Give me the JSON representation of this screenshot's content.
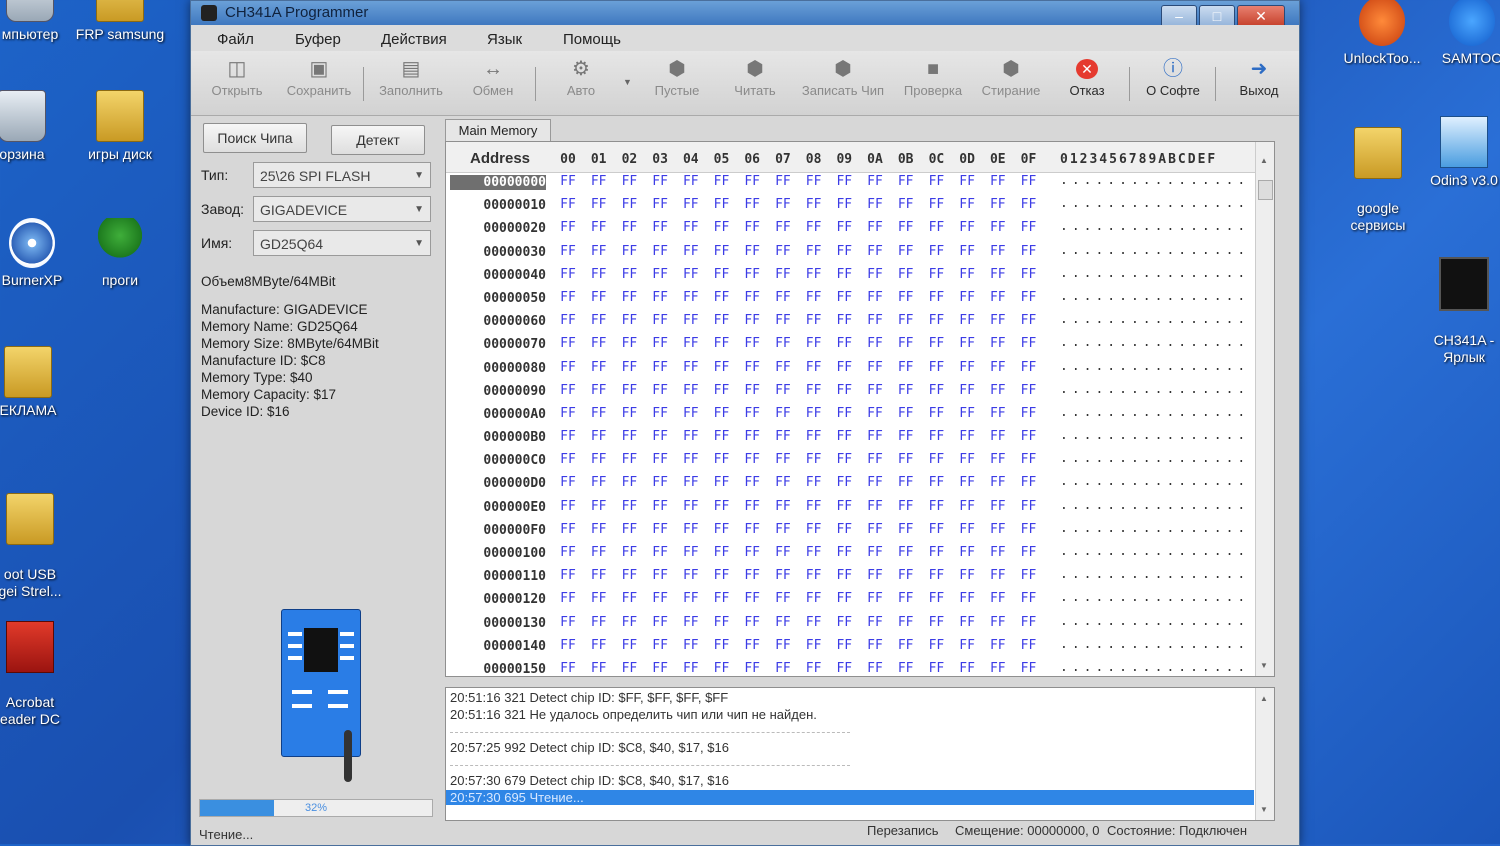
{
  "desktop": {
    "left_icons": [
      {
        "label": "мпьютер",
        "icon": "computer-icon"
      },
      {
        "label": "FRP samsung",
        "icon": "folder-icon"
      },
      {
        "label": "орзина",
        "icon": "recycle-bin-icon"
      },
      {
        "label": "игры диск",
        "icon": "folder-icon"
      },
      {
        "label": "BurnerXP",
        "icon": "cd-burner-icon"
      },
      {
        "label": "проги",
        "icon": "tree-icon"
      },
      {
        "label": "ЕКЛАМА",
        "icon": "folder-icon"
      },
      {
        "label": "oot USB\ngei Strel...",
        "icon": "folder-icon"
      },
      {
        "label": "Acrobat\neader DC",
        "icon": "pdf-icon"
      }
    ],
    "right_icons": [
      {
        "label": "UnlockToo...",
        "icon": "unlock-tool-icon"
      },
      {
        "label": "SAMTOO",
        "icon": "samtool-icon"
      },
      {
        "label": "google\nсервисы",
        "icon": "folder-icon"
      },
      {
        "label": "Odin3 v3.0",
        "icon": "odin-icon"
      },
      {
        "label": "CH341A -\nЯрлык",
        "icon": "chip-shortcut-icon"
      }
    ]
  },
  "window": {
    "title": "CH341A Programmer",
    "menu": [
      "Файл",
      "Буфер",
      "Действия",
      "Язык",
      "Помощь"
    ],
    "toolbar": [
      {
        "label": "Открыть",
        "icon": "open-icon"
      },
      {
        "label": "Сохранить",
        "icon": "save-icon"
      },
      {
        "label": "Заполнить",
        "icon": "fill-icon"
      },
      {
        "label": "Обмен",
        "icon": "swap-icon"
      },
      {
        "label": "Авто",
        "icon": "auto-icon"
      },
      {
        "label": "Пустые",
        "icon": "blank-check-icon"
      },
      {
        "label": "Читать",
        "icon": "read-icon"
      },
      {
        "label": "Записать Чип",
        "icon": "write-chip-icon"
      },
      {
        "label": "Проверка",
        "icon": "verify-icon"
      },
      {
        "label": "Стирание",
        "icon": "erase-icon"
      },
      {
        "label": "Отказ",
        "icon": "cancel-icon"
      },
      {
        "label": "О Софте",
        "icon": "about-icon"
      },
      {
        "label": "Выход",
        "icon": "exit-icon"
      }
    ]
  },
  "left": {
    "search_button": "Поиск Чипа",
    "detect_button": "Детект",
    "type_label": "Тип:",
    "type_value": "25\\26 SPI FLASH",
    "vendor_label": "Завод:",
    "vendor_value": "GIGADEVICE",
    "name_label": "Имя:",
    "name_value": "GD25Q64",
    "volume": "Объем8MByte/64MBit",
    "info": [
      "Manufacture: GIGADEVICE",
      "Memory Name: GD25Q64",
      "Memory Size: 8MByte/64MBit",
      "Manufacture ID: $C8",
      "Memory Type: $40",
      "Memory Capacity: $17",
      "Device ID: $16"
    ],
    "progress_percent": 32,
    "progress_text": "32%",
    "status": "Чтение..."
  },
  "hex": {
    "tab": "Main Memory",
    "address_header": "Address",
    "columns": [
      "00",
      "01",
      "02",
      "03",
      "04",
      "05",
      "06",
      "07",
      "08",
      "09",
      "0A",
      "0B",
      "0C",
      "0D",
      "0E",
      "0F"
    ],
    "ascii_header": "0123456789ABCDEF",
    "addresses": [
      "00000000",
      "00000010",
      "00000020",
      "00000030",
      "00000040",
      "00000050",
      "00000060",
      "00000070",
      "00000080",
      "00000090",
      "000000A0",
      "000000B0",
      "000000C0",
      "000000D0",
      "000000E0",
      "000000F0",
      "00000100",
      "00000110",
      "00000120",
      "00000130",
      "00000140",
      "00000150"
    ],
    "byte_value": "FF",
    "ascii_row": "................"
  },
  "log": [
    "20:51:16 321 Detect chip ID: $FF, $FF, $FF, $FF",
    "20:51:16 321 Не удалось определить чип или чип не найден.",
    "20:57:25 992 Detect chip ID: $C8, $40, $17, $16",
    "20:57:30 679 Detect chip ID: $C8, $40, $17, $16",
    "20:57:30 695 Чтение..."
  ],
  "statusbar": {
    "mode": "Перезапись",
    "offset": "Смещение: 00000000, 0",
    "state": "Состояние: Подключен"
  }
}
